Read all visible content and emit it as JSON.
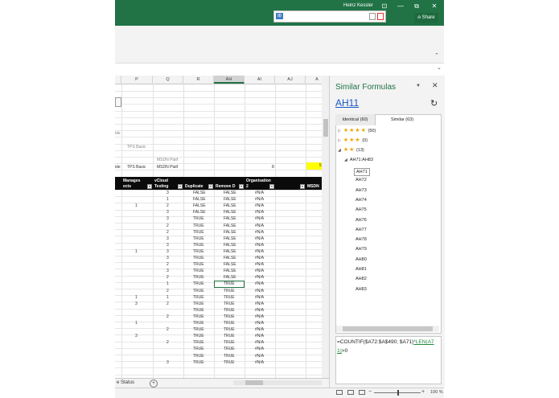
{
  "titlebar": {
    "user_name": "Heinz Kessler",
    "share_label": "Share",
    "minimize": "—",
    "restore": "⧉",
    "close": "✕"
  },
  "grid": {
    "columns": [
      "P",
      "Q",
      "R",
      "AH",
      "AI",
      "AJ",
      "A"
    ],
    "selected_column": "AH",
    "side_label_1": "ide",
    "side_label_2": "ide",
    "tps_basic_1": "TPS Basic",
    "tps_basic_2": "TPS Basic",
    "msdn_platf_1": "MSDN Platf",
    "msdn_platf_2": "MSDN Platf",
    "value_8": "8",
    "yellow_value": "5",
    "headers": {
      "manages": "Manages",
      "ects": "ects",
      "vcloud": "vCloud",
      "testing": "Testing",
      "duplicate": "Duplicate",
      "remove": "Remove D",
      "organisation": "Organisation",
      "organisation2": "2",
      "msdn": "MSDN"
    },
    "rows": [
      {
        "p": "",
        "q": "3",
        "r": "FALSE",
        "ah": "FALSE",
        "ai": "#N/A"
      },
      {
        "p": "",
        "q": "1",
        "r": "FALSE",
        "ah": "FALSE",
        "ai": "#N/A"
      },
      {
        "p": "1",
        "q": "2",
        "r": "FALSE",
        "ah": "FALSE",
        "ai": "#N/A"
      },
      {
        "p": "",
        "q": "3",
        "r": "FALSE",
        "ah": "FALSE",
        "ai": "#N/A"
      },
      {
        "p": "",
        "q": "3",
        "r": "TRUE",
        "ah": "FALSE",
        "ai": "#N/A"
      },
      {
        "p": "",
        "q": "2",
        "r": "TRUE",
        "ah": "FALSE",
        "ai": "#N/A"
      },
      {
        "p": "",
        "q": "2",
        "r": "TRUE",
        "ah": "FALSE",
        "ai": "#N/A"
      },
      {
        "p": "",
        "q": "3",
        "r": "TRUE",
        "ah": "FALSE",
        "ai": "#N/A"
      },
      {
        "p": "",
        "q": "3",
        "r": "TRUE",
        "ah": "FALSE",
        "ai": "#N/A"
      },
      {
        "p": "1",
        "q": "3",
        "r": "TRUE",
        "ah": "FALSE",
        "ai": "#N/A"
      },
      {
        "p": "",
        "q": "3",
        "r": "TRUE",
        "ah": "FALSE",
        "ai": "#N/A"
      },
      {
        "p": "",
        "q": "2",
        "r": "TRUE",
        "ah": "FALSE",
        "ai": "#N/A"
      },
      {
        "p": "",
        "q": "3",
        "r": "TRUE",
        "ah": "FALSE",
        "ai": "#N/A"
      },
      {
        "p": "",
        "q": "2",
        "r": "TRUE",
        "ah": "FALSE",
        "ai": "#N/A"
      },
      {
        "p": "",
        "q": "1",
        "r": "TRUE",
        "ah": "TRUE",
        "ai": "#N/A"
      },
      {
        "p": "",
        "q": "2",
        "r": "TRUE",
        "ah": "TRUE",
        "ai": "#N/A"
      },
      {
        "p": "1",
        "q": "1",
        "r": "TRUE",
        "ah": "TRUE",
        "ai": "#N/A"
      },
      {
        "p": "3",
        "q": "2",
        "r": "TRUE",
        "ah": "TRUE",
        "ai": "#N/A"
      },
      {
        "p": "",
        "q": "",
        "r": "TRUE",
        "ah": "TRUE",
        "ai": "#N/A"
      },
      {
        "p": "",
        "q": "2",
        "r": "TRUE",
        "ah": "TRUE",
        "ai": "#N/A"
      },
      {
        "p": "1",
        "q": "",
        "r": "TRUE",
        "ah": "TRUE",
        "ai": "#N/A"
      },
      {
        "p": "",
        "q": "2",
        "r": "TRUE",
        "ah": "TRUE",
        "ai": "#N/A"
      },
      {
        "p": "3",
        "q": "",
        "r": "TRUE",
        "ah": "TRUE",
        "ai": "#N/A"
      },
      {
        "p": "",
        "q": "2",
        "r": "TRUE",
        "ah": "TRUE",
        "ai": "#N/A"
      },
      {
        "p": "",
        "q": "",
        "r": "TRUE",
        "ah": "TRUE",
        "ai": "#N/A"
      },
      {
        "p": "",
        "q": "",
        "r": "TRUE",
        "ah": "TRUE",
        "ai": "#N/A"
      },
      {
        "p": "",
        "q": "3",
        "r": "TRUE",
        "ah": "TRUE",
        "ai": "#N/A"
      }
    ]
  },
  "sheet": {
    "tab_label": "e Status",
    "add_symbol": "+"
  },
  "statusbar": {
    "zoom": "100 %",
    "minus": "−",
    "plus": "+"
  },
  "pane": {
    "title": "Similar Formulas",
    "menu": "▼",
    "close": "✕",
    "cell_ref": "AH11",
    "refresh": "↻",
    "tab_identical": "Identical (60)",
    "tab_similar": "Similar (63)",
    "groups": [
      {
        "arrow": "▷",
        "stars": "★★★★",
        "count": "(50)"
      },
      {
        "arrow": "▷",
        "stars": "★★★",
        "count": "(0)"
      },
      {
        "arrow": "◢",
        "stars": "★★",
        "count": "(13)"
      }
    ],
    "subgroup": "AH71:AH83",
    "subgroup_arrow": "◢",
    "items": [
      "AH71",
      "AH72",
      "AH73",
      "AH74",
      "AH75",
      "AH76",
      "AH77",
      "AH78",
      "AH79",
      "AH80",
      "AH81",
      "AH82",
      "AH83"
    ],
    "formula_part1": "=COUNTIF($A72:$A$490;",
    "formula_part2": "$A71)",
    "formula_link": "*LEN(A71)",
    "formula_part3": ">0"
  },
  "colors": {
    "excel_green": "#217346",
    "star_orange": "#f0a30a",
    "link_blue": "#1a56c8"
  }
}
